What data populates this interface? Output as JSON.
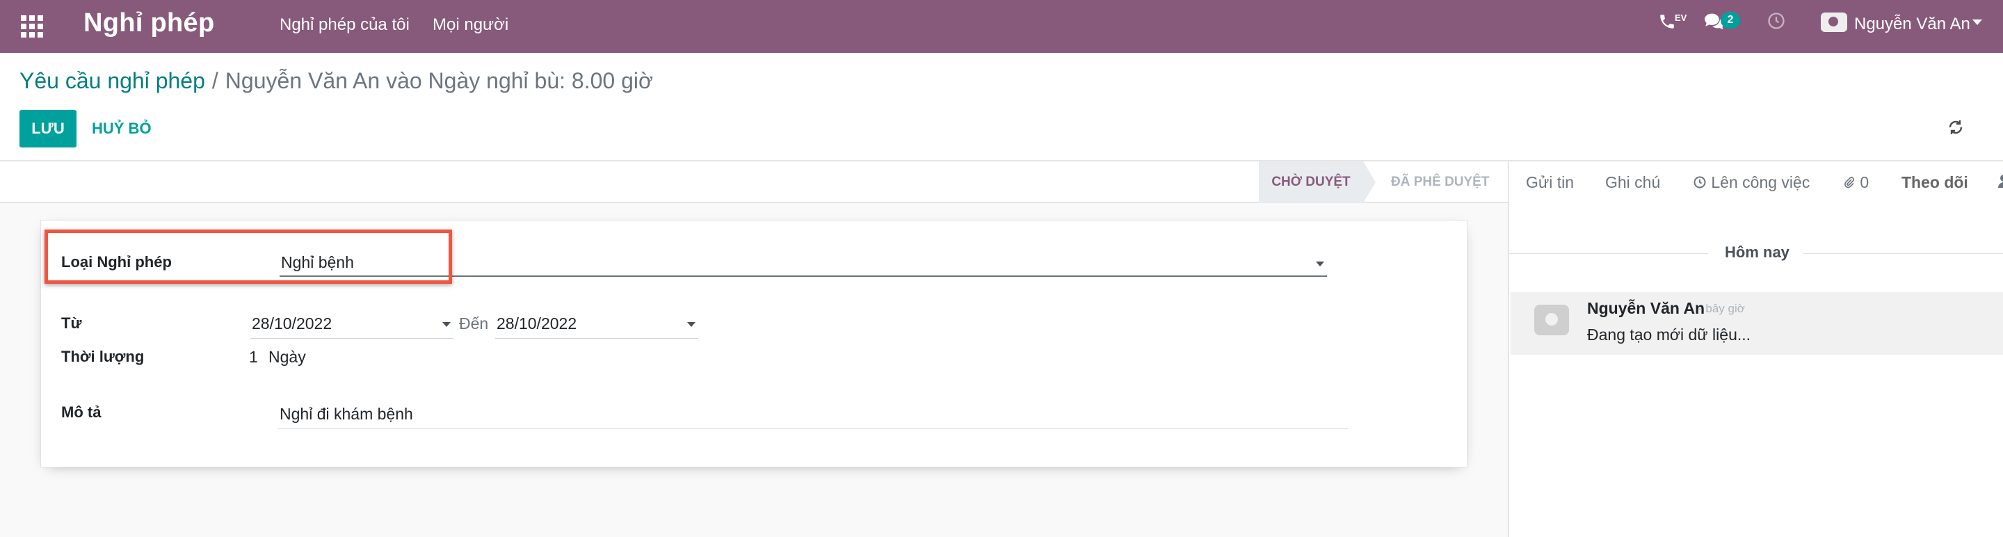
{
  "navbar": {
    "app_title": "Nghỉ phép",
    "menu": [
      "Nghỉ phép của tôi",
      "Mọi người"
    ],
    "phone_badge": "EV",
    "messages_count": "2",
    "user_name": "Nguyễn Văn An",
    "background_color": "#875A7B"
  },
  "breadcrumb": {
    "parent": "Yêu cầu nghỉ phép",
    "separator": "/",
    "current": "Nguyễn Văn An vào Ngày nghỉ bù: 8.00 giờ"
  },
  "buttons": {
    "save": "LƯU",
    "discard": "HUỶ BỎ"
  },
  "statusbar": {
    "current_stage": "CHỜ DUYỆT",
    "next_stage": "ĐÃ PHÊ DUYỆT"
  },
  "form": {
    "leave_type_label": "Loại Nghỉ phép",
    "leave_type_value": "Nghỉ bệnh",
    "from_label": "Từ",
    "from_value": "28/10/2022",
    "to_label": "Đến",
    "to_value": "28/10/2022",
    "duration_label": "Thời lượng",
    "duration_value": "1",
    "duration_unit": "Ngày",
    "description_label": "Mô tả",
    "description_value": "Nghỉ đi khám bệnh"
  },
  "chatter": {
    "send_message": "Gửi tin",
    "log_note": "Ghi chú",
    "schedule_activity": "Lên công việc",
    "attachments_count": "0",
    "follow": "Theo dõi",
    "today_label": "Hôm nay",
    "message": {
      "author": "Nguyễn Văn An",
      "date": "- bây giờ",
      "body": "Đang tạo mới dữ liệu..."
    }
  },
  "colors": {
    "primary": "#00A09D",
    "brand": "#875A7B",
    "highlight_border": "#F05540"
  }
}
